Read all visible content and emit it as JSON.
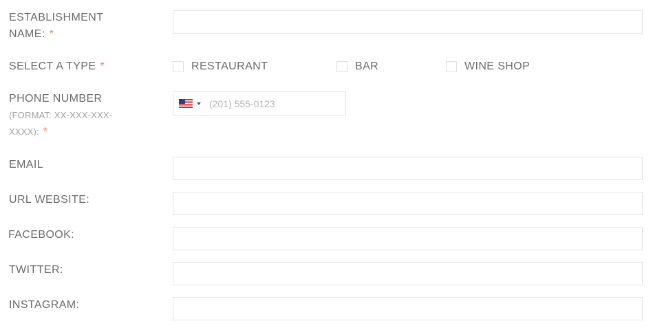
{
  "form": {
    "establishment": {
      "label_line1": "ESTABLISHMENT",
      "label_line2": "NAME:",
      "required_mark": "*",
      "value": ""
    },
    "type": {
      "label": "SELECT A TYPE",
      "required_mark": "*",
      "options": [
        {
          "label": "RESTAURANT",
          "checked": false
        },
        {
          "label": "BAR",
          "checked": false
        },
        {
          "label": "WINE SHOP",
          "checked": false
        }
      ]
    },
    "phone": {
      "label": "PHONE NUMBER",
      "format_line1": "(FORMAT: XX-XXX-XXX-",
      "format_line2": "XXXX):",
      "required_mark": "*",
      "country_flag": "us-flag-icon",
      "placeholder": "(201) 555-0123",
      "value": ""
    },
    "email": {
      "label": "EMAIL",
      "value": ""
    },
    "website": {
      "label": "URL WEBSITE:",
      "value": ""
    },
    "facebook": {
      "label": "FACEBOOK:",
      "value": ""
    },
    "twitter": {
      "label": "TWITTER:",
      "value": ""
    },
    "instagram": {
      "label": "INSTAGRAM:",
      "value": ""
    }
  },
  "colors": {
    "label": "#6b6b6b",
    "required": "#e8806a",
    "hint": "#a0a0a0",
    "border": "#e3e3e3"
  }
}
